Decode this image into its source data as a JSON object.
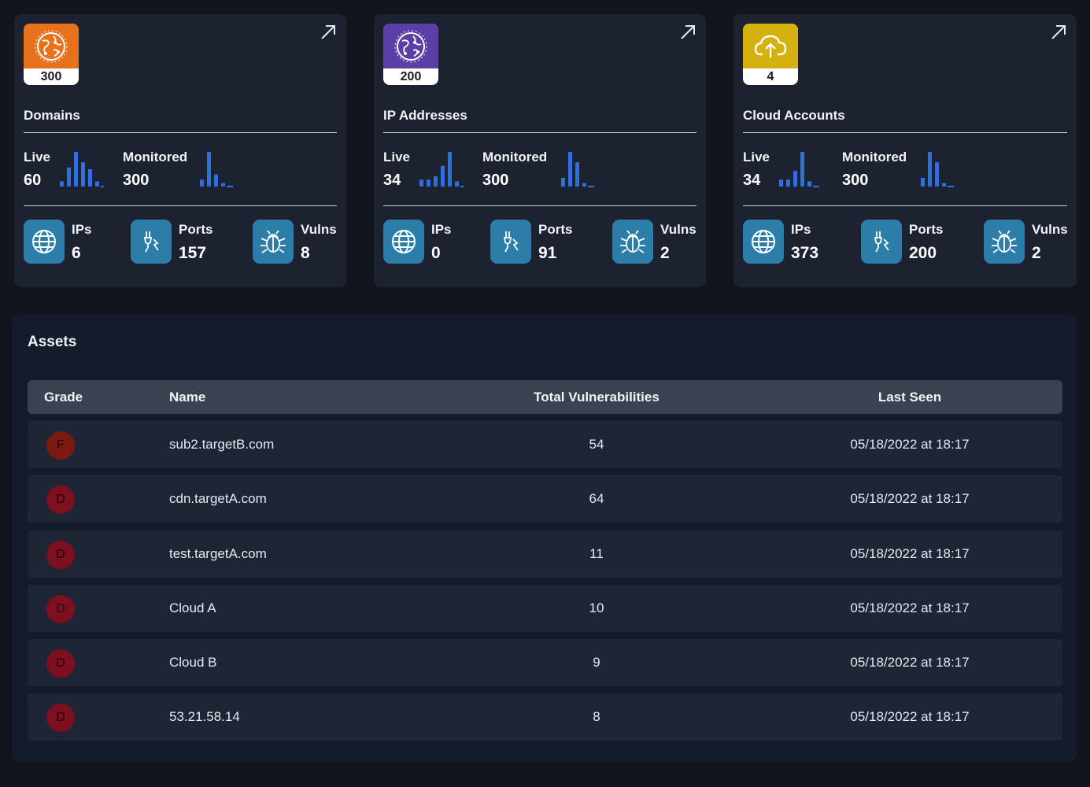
{
  "colors": {
    "page_bg": "#0f141d",
    "card_bg": "#1c2230",
    "spark_blue": "#2f6fe0",
    "metric_icon_bg": "#2c7ea8"
  },
  "cards": [
    {
      "title": "Domains",
      "badge_count": "300",
      "badge_color": "#e8711b",
      "badge_icon": "globe-network-icon",
      "live_label": "Live",
      "live_value": "60",
      "monitored_label": "Monitored",
      "monitored_value": "300",
      "live_spark": [
        0.15,
        0.55,
        1.0,
        0.7,
        0.5,
        0.15
      ],
      "monitored_spark": [
        0.2,
        1.0,
        0.35,
        0.1
      ],
      "ips_label": "IPs",
      "ips_value": "6",
      "ports_label": "Ports",
      "ports_value": "157",
      "vulns_label": "Vulns",
      "vulns_value": "8"
    },
    {
      "title": "IP Addresses",
      "badge_count": "200",
      "badge_color": "#5a3fa6",
      "badge_icon": "globe-network-icon",
      "live_label": "Live",
      "live_value": "34",
      "monitored_label": "Monitored",
      "monitored_value": "300",
      "live_spark": [
        0.2,
        0.2,
        0.3,
        0.6,
        1.0,
        0.15
      ],
      "monitored_spark": [
        0.25,
        1.0,
        0.7,
        0.1
      ],
      "ips_label": "IPs",
      "ips_value": "0",
      "ports_label": "Ports",
      "ports_value": "91",
      "vulns_label": "Vulns",
      "vulns_value": "2"
    },
    {
      "title": "Cloud Accounts",
      "badge_count": "4",
      "badge_color": "#d4b10e",
      "badge_icon": "cloud-upload-icon",
      "live_label": "Live",
      "live_value": "34",
      "monitored_label": "Monitored",
      "monitored_value": "300",
      "live_spark": [
        0.2,
        0.2,
        0.45,
        1.0,
        0.15
      ],
      "monitored_spark": [
        0.25,
        1.0,
        0.7,
        0.1
      ],
      "ips_label": "IPs",
      "ips_value": "373",
      "ports_label": "Ports",
      "ports_value": "200",
      "vulns_label": "Vulns",
      "vulns_value": "2"
    }
  ],
  "assets": {
    "title": "Assets",
    "headers": {
      "grade": "Grade",
      "name": "Name",
      "total_vulns": "Total Vulnerabilities",
      "last_seen": "Last Seen"
    },
    "rows": [
      {
        "grade": "F",
        "grade_color": "#7a1a10",
        "name": "sub2.targetB.com",
        "total_vulns": "54",
        "last_seen": "05/18/2022 at 18:17"
      },
      {
        "grade": "D",
        "grade_color": "#7d0f1f",
        "name": "cdn.targetA.com",
        "total_vulns": "64",
        "last_seen": "05/18/2022 at 18:17"
      },
      {
        "grade": "D",
        "grade_color": "#7d0f1f",
        "name": "test.targetA.com",
        "total_vulns": "11",
        "last_seen": "05/18/2022 at 18:17"
      },
      {
        "grade": "D",
        "grade_color": "#7d0f1f",
        "name": "Cloud A",
        "total_vulns": "10",
        "last_seen": "05/18/2022 at 18:17"
      },
      {
        "grade": "D",
        "grade_color": "#7d0f1f",
        "name": "Cloud B",
        "total_vulns": "9",
        "last_seen": "05/18/2022 at 18:17"
      },
      {
        "grade": "D",
        "grade_color": "#7d0f1f",
        "name": "53.21.58.14",
        "total_vulns": "8",
        "last_seen": "05/18/2022 at 18:17"
      }
    ]
  }
}
